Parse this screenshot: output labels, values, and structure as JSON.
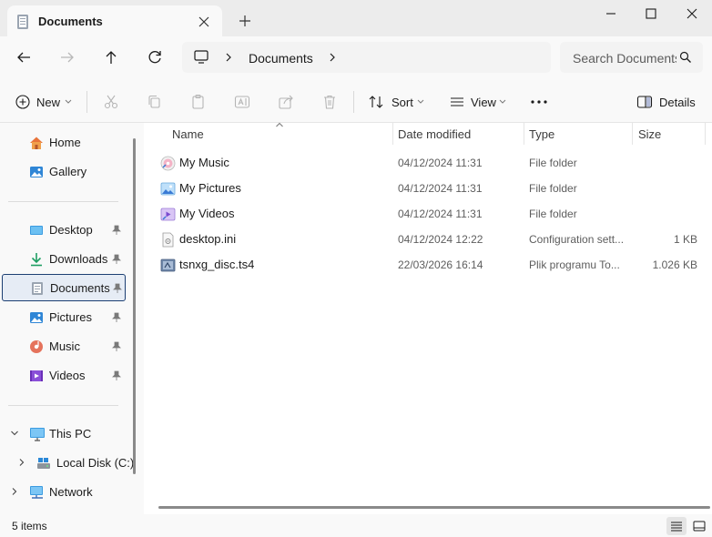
{
  "window": {
    "tab_title": "Documents"
  },
  "address": {
    "breadcrumb": [
      "Documents"
    ],
    "search_placeholder": "Search Documents"
  },
  "toolbar": {
    "new_label": "New",
    "sort_label": "Sort",
    "view_label": "View",
    "details_label": "Details"
  },
  "sidebar": {
    "items": [
      {
        "label": "Home",
        "icon": "home-icon"
      },
      {
        "label": "Gallery",
        "icon": "gallery-icon"
      },
      {
        "label": "Desktop",
        "icon": "desktop-icon",
        "pinned": true
      },
      {
        "label": "Downloads",
        "icon": "downloads-icon",
        "pinned": true
      },
      {
        "label": "Documents",
        "icon": "documents-icon",
        "pinned": true,
        "selected": true
      },
      {
        "label": "Pictures",
        "icon": "pictures-icon",
        "pinned": true
      },
      {
        "label": "Music",
        "icon": "music-icon",
        "pinned": true
      },
      {
        "label": "Videos",
        "icon": "videos-icon",
        "pinned": true
      },
      {
        "label": "This PC",
        "icon": "this-pc-icon",
        "expanded": true
      },
      {
        "label": "Local Disk (C:)",
        "icon": "local-disk-icon"
      },
      {
        "label": "Network",
        "icon": "network-icon"
      }
    ]
  },
  "table": {
    "columns": [
      "Name",
      "Date modified",
      "Type",
      "Size"
    ],
    "rows": [
      {
        "name": "My Music",
        "date": "04/12/2024 11:31",
        "type": "File folder",
        "size": "",
        "icon": "music-folder-icon"
      },
      {
        "name": "My Pictures",
        "date": "04/12/2024 11:31",
        "type": "File folder",
        "size": "",
        "icon": "pictures-folder-icon"
      },
      {
        "name": "My Videos",
        "date": "04/12/2024 11:31",
        "type": "File folder",
        "size": "",
        "icon": "videos-folder-icon"
      },
      {
        "name": "desktop.ini",
        "date": "04/12/2024 12:22",
        "type": "Configuration sett...",
        "size": "1 KB",
        "icon": "config-file-icon"
      },
      {
        "name": "tsnxg_disc.ts4",
        "date": "22/03/2026 16:14",
        "type": "Plik programu To...",
        "size": "1.026 KB",
        "icon": "ts4-file-icon"
      }
    ]
  },
  "status": {
    "item_count": "5 items"
  },
  "colors": {
    "accent": "#0067c0",
    "selection_border": "#1c3f73",
    "selection_bg": "#e6ecf5"
  }
}
